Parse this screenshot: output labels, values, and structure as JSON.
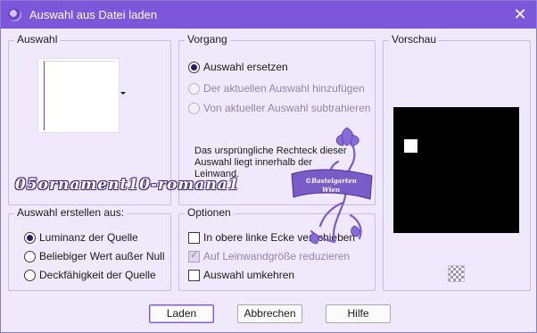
{
  "window": {
    "title": "Auswahl aus Datei laden",
    "close_glyph": "✕"
  },
  "auswahl": {
    "label": "Auswahl"
  },
  "vorgang": {
    "label": "Vorgang",
    "options": [
      {
        "label": "Auswahl ersetzen",
        "checked": true,
        "enabled": true
      },
      {
        "label": "Der aktuellen Auswahl hinzufügen",
        "checked": false,
        "enabled": false
      },
      {
        "label": "Von aktueller Auswahl subtrahieren",
        "checked": false,
        "enabled": false
      }
    ],
    "info": "Das ursprüngliche Rechteck dieser Auswahl liegt innerhalb der Leinwand."
  },
  "vorschau": {
    "label": "Vorschau",
    "transparency_icon": "checkerboard-icon"
  },
  "erstellen": {
    "label": "Auswahl erstellen aus:",
    "options": [
      {
        "label": "Luminanz der Quelle",
        "checked": true
      },
      {
        "label": "Beliebiger Wert außer Null",
        "checked": false
      },
      {
        "label": "Deckfähigkeit der Quelle",
        "checked": false
      }
    ]
  },
  "optionen": {
    "label": "Optionen",
    "items": [
      {
        "label": "In obere linke Ecke verschieben",
        "checked": false,
        "enabled": true
      },
      {
        "label": "Auf Leinwandgröße reduzieren",
        "checked": true,
        "enabled": false
      },
      {
        "label": "Auswahl umkehren",
        "checked": false,
        "enabled": true
      }
    ]
  },
  "buttons": {
    "load": "Laden",
    "cancel": "Abbrechen",
    "help": "Hilfe"
  },
  "watermark": {
    "text": "05ornament10-romana1",
    "stamp_line1": "©Bastelgarten",
    "stamp_line2": "Wien"
  },
  "colors": {
    "titlebar": "#7c56db",
    "dialog_bg": "#efe9fb",
    "accent": "#6b47c9",
    "ornament": "#7a5cc8"
  }
}
